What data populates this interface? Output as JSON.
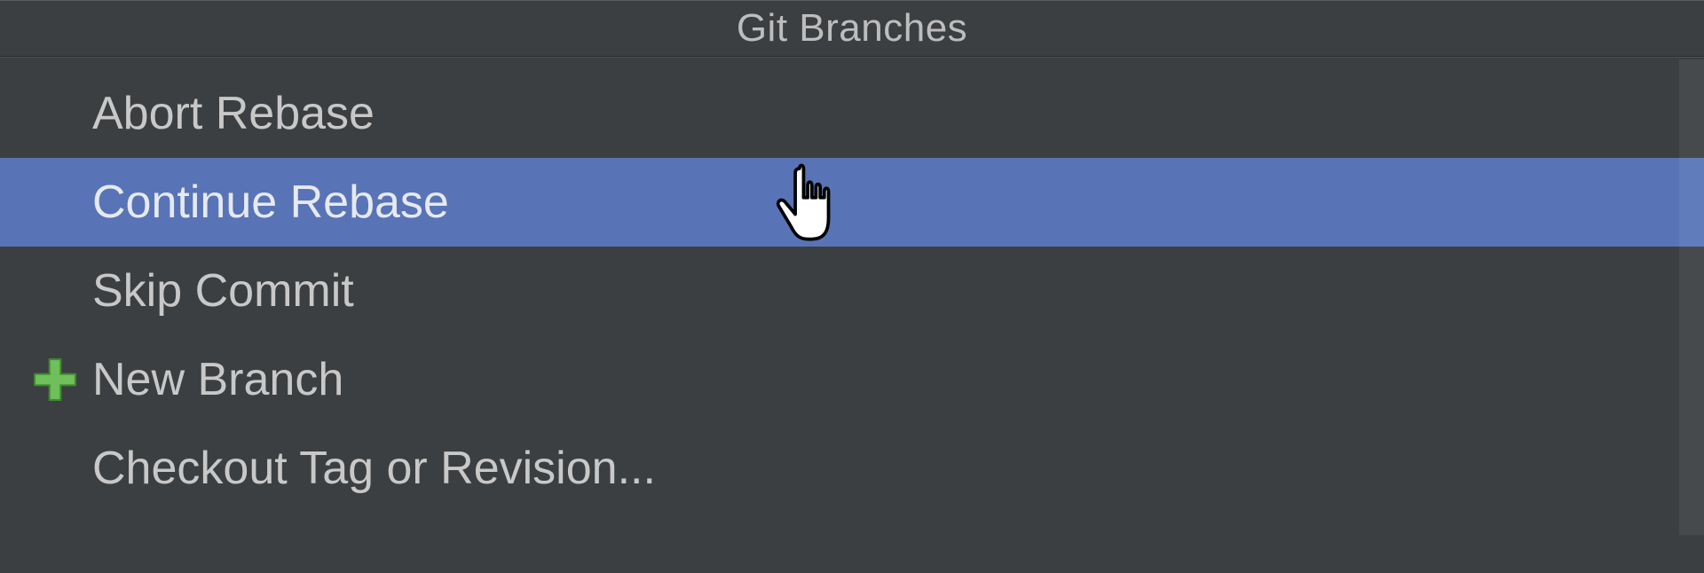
{
  "popup": {
    "title": "Git Branches",
    "items": [
      {
        "label": "Abort Rebase",
        "icon": null,
        "selected": false
      },
      {
        "label": "Continue Rebase",
        "icon": null,
        "selected": true
      },
      {
        "label": "Skip Commit",
        "icon": null,
        "selected": false
      },
      {
        "label": "New Branch",
        "icon": "plus-icon",
        "selected": false
      },
      {
        "label": "Checkout Tag or Revision...",
        "icon": null,
        "selected": false
      }
    ]
  },
  "colors": {
    "background": "#3c3f41",
    "selection": "#5874b6",
    "text": "#c8c8c8",
    "title_text": "#bdbdbd",
    "plus_fill": "#6fbf5a",
    "plus_stroke": "#3d8b2e"
  }
}
